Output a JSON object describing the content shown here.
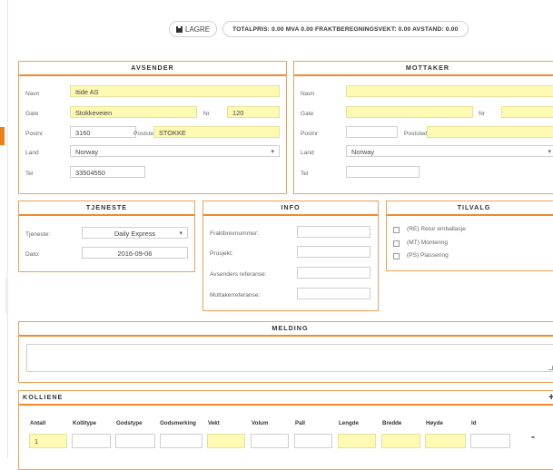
{
  "toolbar": {
    "save_label": "LAGRE",
    "totals": "TOTALPRIS: 0.00   MVA 0.00   FRAKTBEREGNINGSVEKT: 0.00   AVSTAND: 0.00"
  },
  "avsender": {
    "title": "AVSENDER",
    "navn_label": "Navn",
    "navn": "Itide AS",
    "gate_label": "Gate",
    "gate": "Stokkeveien",
    "nr_label": "Nr",
    "nr": "120",
    "postnr_label": "Postnr",
    "postnr": "3160",
    "poststed_label": "Poststed",
    "poststed": "STOKKE",
    "land_label": "Land",
    "land": "Norway",
    "tel_label": "Tel",
    "tel": "33504550"
  },
  "mottaker": {
    "title": "MOTTAKER",
    "navn_label": "Navn",
    "navn": "",
    "gate_label": "Gate",
    "gate": "",
    "nr_label": "Nr",
    "nr": "",
    "postnr_label": "Postnr",
    "postnr": "",
    "poststed_label": "Poststed",
    "poststed": "",
    "land_label": "Land",
    "land": "Norway",
    "tel_label": "Tel",
    "tel": ""
  },
  "tjeneste": {
    "title": "TJENESTE",
    "tjeneste_label": "Tjeneste:",
    "tjeneste": "Daily Express",
    "dato_label": "Dato:",
    "dato": "2016-09-06"
  },
  "info": {
    "title": "INFO",
    "fraktbrev_label": "Fraktbrevnummer:",
    "prosjekt_label": "Prosjekt:",
    "avsref_label": "Avsenders referanse:",
    "mottref_label": "Mottakerreferanse:"
  },
  "tilvalg": {
    "title": "TILVALG",
    "options": [
      "(RE) Retur emballasje",
      "(MT) Montering",
      "(PS) Plassering"
    ]
  },
  "melding": {
    "title": "MELDING"
  },
  "kolliene": {
    "title": "KOLLIENE",
    "plus": "+",
    "minus": "-",
    "headers": [
      "Antall",
      "Kollitype",
      "Godstype",
      "Godsmerking",
      "Vekt",
      "Volum",
      "Pall",
      "Lengde",
      "Bredde",
      "Høyde",
      "Id"
    ],
    "antall": "1"
  },
  "colors": {
    "accent": "#f08a2c",
    "field_highlight": "#fefab4"
  }
}
